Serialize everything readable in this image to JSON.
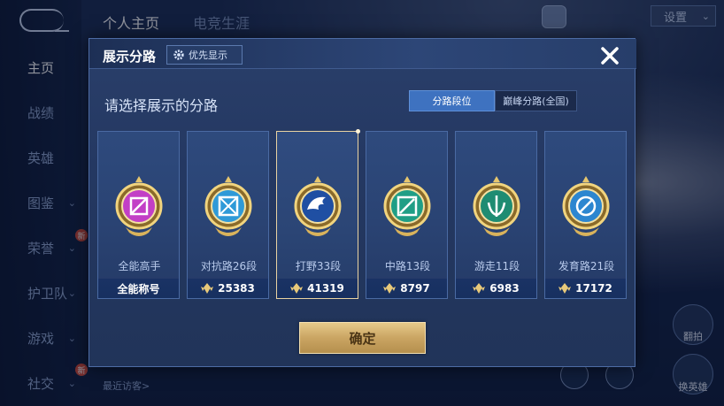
{
  "background": {
    "nav_items": [
      {
        "label": "主页",
        "active": true
      },
      {
        "label": "战绩"
      },
      {
        "label": "英雄"
      },
      {
        "label": "图鉴",
        "chevron": true
      },
      {
        "label": "荣誉",
        "chevron": true,
        "badge": "新"
      },
      {
        "label": "护卫队",
        "chevron": true
      },
      {
        "label": "游戏",
        "chevron": true
      },
      {
        "label": "社交",
        "chevron": true,
        "badge": "新"
      }
    ],
    "top_tabs": [
      {
        "label": "个人主页",
        "active": true
      },
      {
        "label": "电竞生涯"
      }
    ],
    "settings_label": "设置",
    "recent_visitors": "最近访客>",
    "side_actions": [
      {
        "label": "翻拍"
      },
      {
        "label": "换英雄"
      }
    ]
  },
  "modal": {
    "title": "展示分路",
    "priority_label": "优先显示",
    "prompt": "请选择展示的分路",
    "segments": [
      {
        "label": "分路段位",
        "active": true
      },
      {
        "label": "巅峰分路(全国)",
        "active": false
      }
    ],
    "cards": [
      {
        "role": "全能高手",
        "bottom_text": "全能称号",
        "score": null,
        "emblem_color": "#c23fc6",
        "selected": false
      },
      {
        "role": "对抗路26段",
        "score": "25383",
        "emblem_color": "#2f9ad8",
        "selected": false
      },
      {
        "role": "打野33段",
        "score": "41319",
        "emblem_color": "#1f4fa3",
        "selected": true
      },
      {
        "role": "中路13段",
        "score": "8797",
        "emblem_color": "#1f9e86",
        "selected": false
      },
      {
        "role": "游走11段",
        "score": "6983",
        "emblem_color": "#1e8c72",
        "selected": false
      },
      {
        "role": "发育路21段",
        "score": "17172",
        "emblem_color": "#2c86d0",
        "selected": false
      }
    ],
    "confirm_label": "确定"
  },
  "colors": {
    "accent_blue": "#3e72c0",
    "gold": "#caa563",
    "selected_border": "#e9d3a2"
  }
}
